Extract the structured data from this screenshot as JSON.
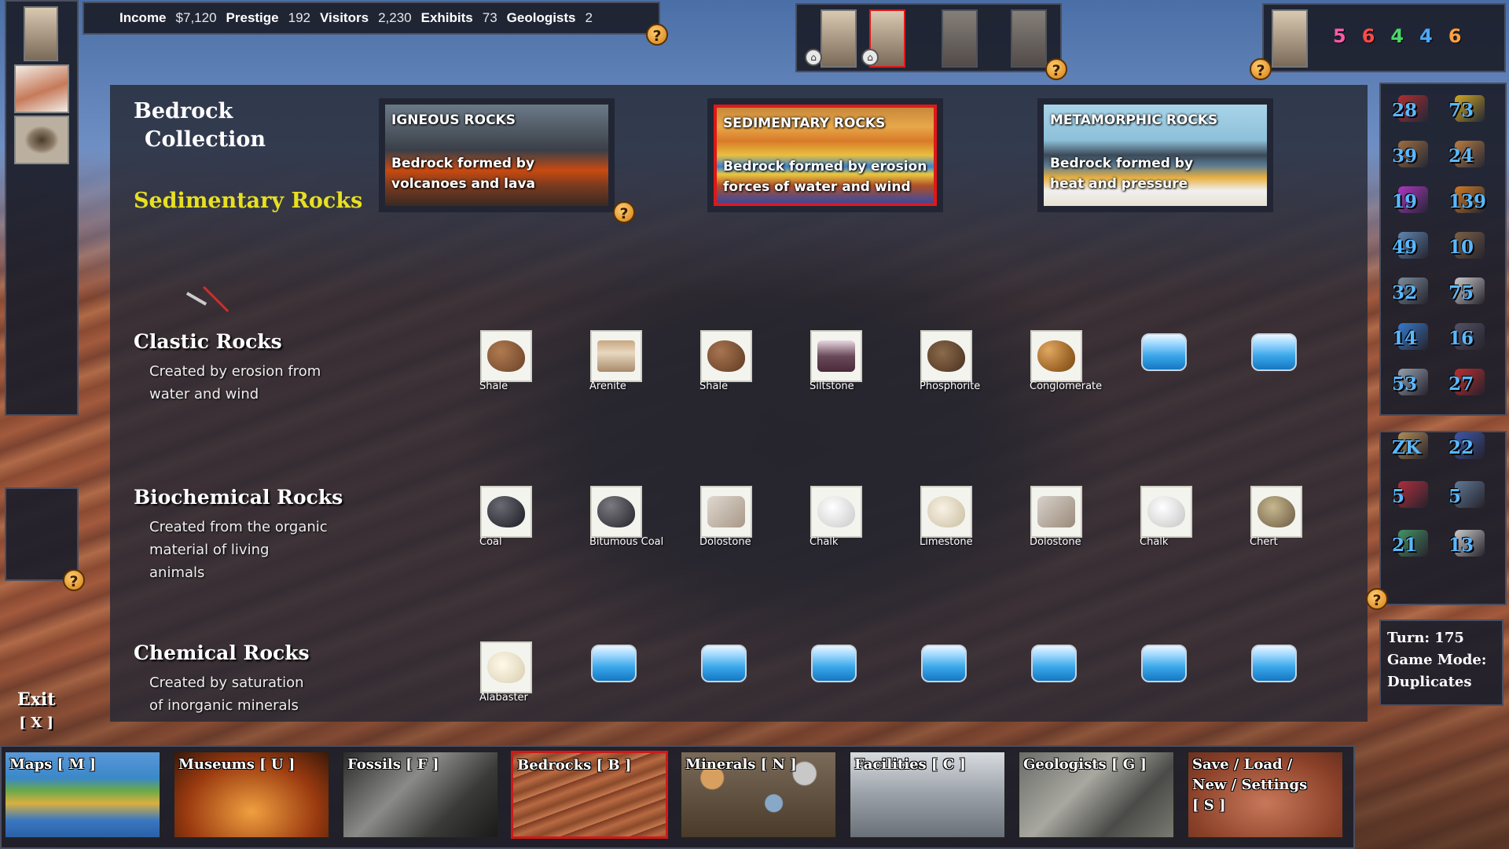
{
  "topbar": {
    "income_label": "Income",
    "income_value": "$7,120",
    "prestige_label": "Prestige",
    "prestige_value": "192",
    "visitors_label": "Visitors",
    "visitors_value": "2,230",
    "exhibits_label": "Exhibits",
    "exhibits_value": "73",
    "geologists_label": "Geologists",
    "geologists_value": "2"
  },
  "help_glyph": "?",
  "player_counts": [
    "5",
    "6",
    "4",
    "4",
    "6"
  ],
  "player_count_colors": [
    "#ff5aa8",
    "#ff4a4a",
    "#4ad86a",
    "#4aa8ff",
    "#ffa040"
  ],
  "page": {
    "title_line1": "Bedrock",
    "title_line2": "Collection",
    "subtitle": "Sedimentary Rocks"
  },
  "categories": [
    {
      "title": "IGNEOUS ROCKS",
      "desc_line1": "Bedrock formed by",
      "desc_line2": "volcanoes and lava"
    },
    {
      "title": "SEDIMENTARY ROCKS",
      "desc_line1": "Bedrock formed by erosion",
      "desc_line2": "forces of water and wind"
    },
    {
      "title": "METAMORPHIC ROCKS",
      "desc_line1": "Bedrock formed by",
      "desc_line2": "heat and pressure"
    }
  ],
  "sections": {
    "clastic": {
      "title": "Clastic Rocks",
      "desc_line1": "Created by erosion from",
      "desc_line2": "water and wind",
      "items": [
        "Shale",
        "Arenite",
        "Shale",
        "Siltstone",
        "Phosphorite",
        "Conglomerate"
      ]
    },
    "biochemical": {
      "title": "Biochemical Rocks",
      "desc_line1": "Created from the organic",
      "desc_line2": "material of living",
      "desc_line3": "animals",
      "items": [
        "Coal",
        "Bitumous Coal",
        "Dolostone",
        "Chalk",
        "Limestone",
        "Dolostone",
        "Chalk",
        "Chert"
      ]
    },
    "chemical": {
      "title": "Chemical Rocks",
      "desc_line1": "Created by saturation",
      "desc_line2": "of inorganic minerals",
      "items": [
        "Alabaster"
      ]
    }
  },
  "stats_top": [
    "28",
    "73",
    "39",
    "24",
    "19",
    "139",
    "49",
    "10",
    "32",
    "75",
    "14",
    "16",
    "53",
    "27"
  ],
  "stats_bottom": [
    "ZK",
    "22",
    "5",
    "5",
    "21",
    "13"
  ],
  "turn_label": "Turn: 175",
  "game_mode_label": "Game Mode:",
  "game_mode_value": "Duplicates",
  "exit": {
    "label": "Exit",
    "shortcut": "[ X ]"
  },
  "nav": [
    {
      "label": "Maps [ M ]"
    },
    {
      "label": "Museums [ U ]"
    },
    {
      "label": "Fossils [ F ]"
    },
    {
      "label": "Bedrocks [ B ]"
    },
    {
      "label": "Minerals [ N ]"
    },
    {
      "label": "Facilities [ C ]"
    },
    {
      "label": "Geologists [ G ]"
    },
    {
      "label": "Save / Load /",
      "label2": "New / Settings",
      "label3": "[ S ]"
    }
  ]
}
